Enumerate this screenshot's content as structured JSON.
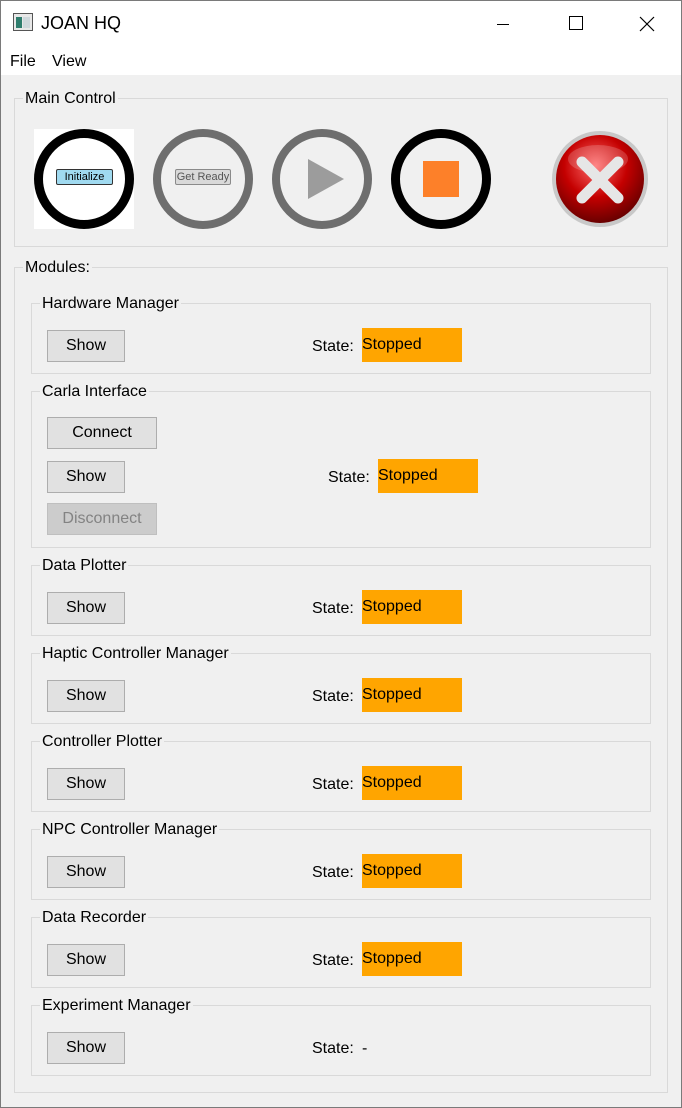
{
  "window": {
    "title": "JOAN HQ"
  },
  "menu": {
    "file": "File",
    "view": "View"
  },
  "main_control": {
    "title": "Main Control",
    "initialize_label": "Initialize",
    "get_ready_label": "Get Ready"
  },
  "modules": {
    "title": "Modules:",
    "state_label": "State:",
    "show_label": "Show",
    "hardware_manager": {
      "title": "Hardware Manager",
      "state": "Stopped"
    },
    "carla_interface": {
      "title": "Carla Interface",
      "connect_label": "Connect",
      "disconnect_label": "Disconnect",
      "state": "Stopped"
    },
    "data_plotter": {
      "title": "Data Plotter",
      "state": "Stopped"
    },
    "haptic_controller_manager": {
      "title": "Haptic Controller Manager",
      "state": "Stopped"
    },
    "controller_plotter": {
      "title": "Controller Plotter",
      "state": "Stopped"
    },
    "npc_controller_manager": {
      "title": "NPC Controller Manager",
      "state": "Stopped"
    },
    "data_recorder": {
      "title": "Data Recorder",
      "state": "Stopped"
    },
    "experiment_manager": {
      "title": "Experiment Manager",
      "state": "-"
    }
  },
  "colors": {
    "state_stopped": "#ffa500",
    "stop_square": "#fd8029",
    "exit_red": "#c00000"
  },
  "icons": {
    "start": "play-icon",
    "stop": "stop-icon",
    "exit": "close-x-icon"
  }
}
